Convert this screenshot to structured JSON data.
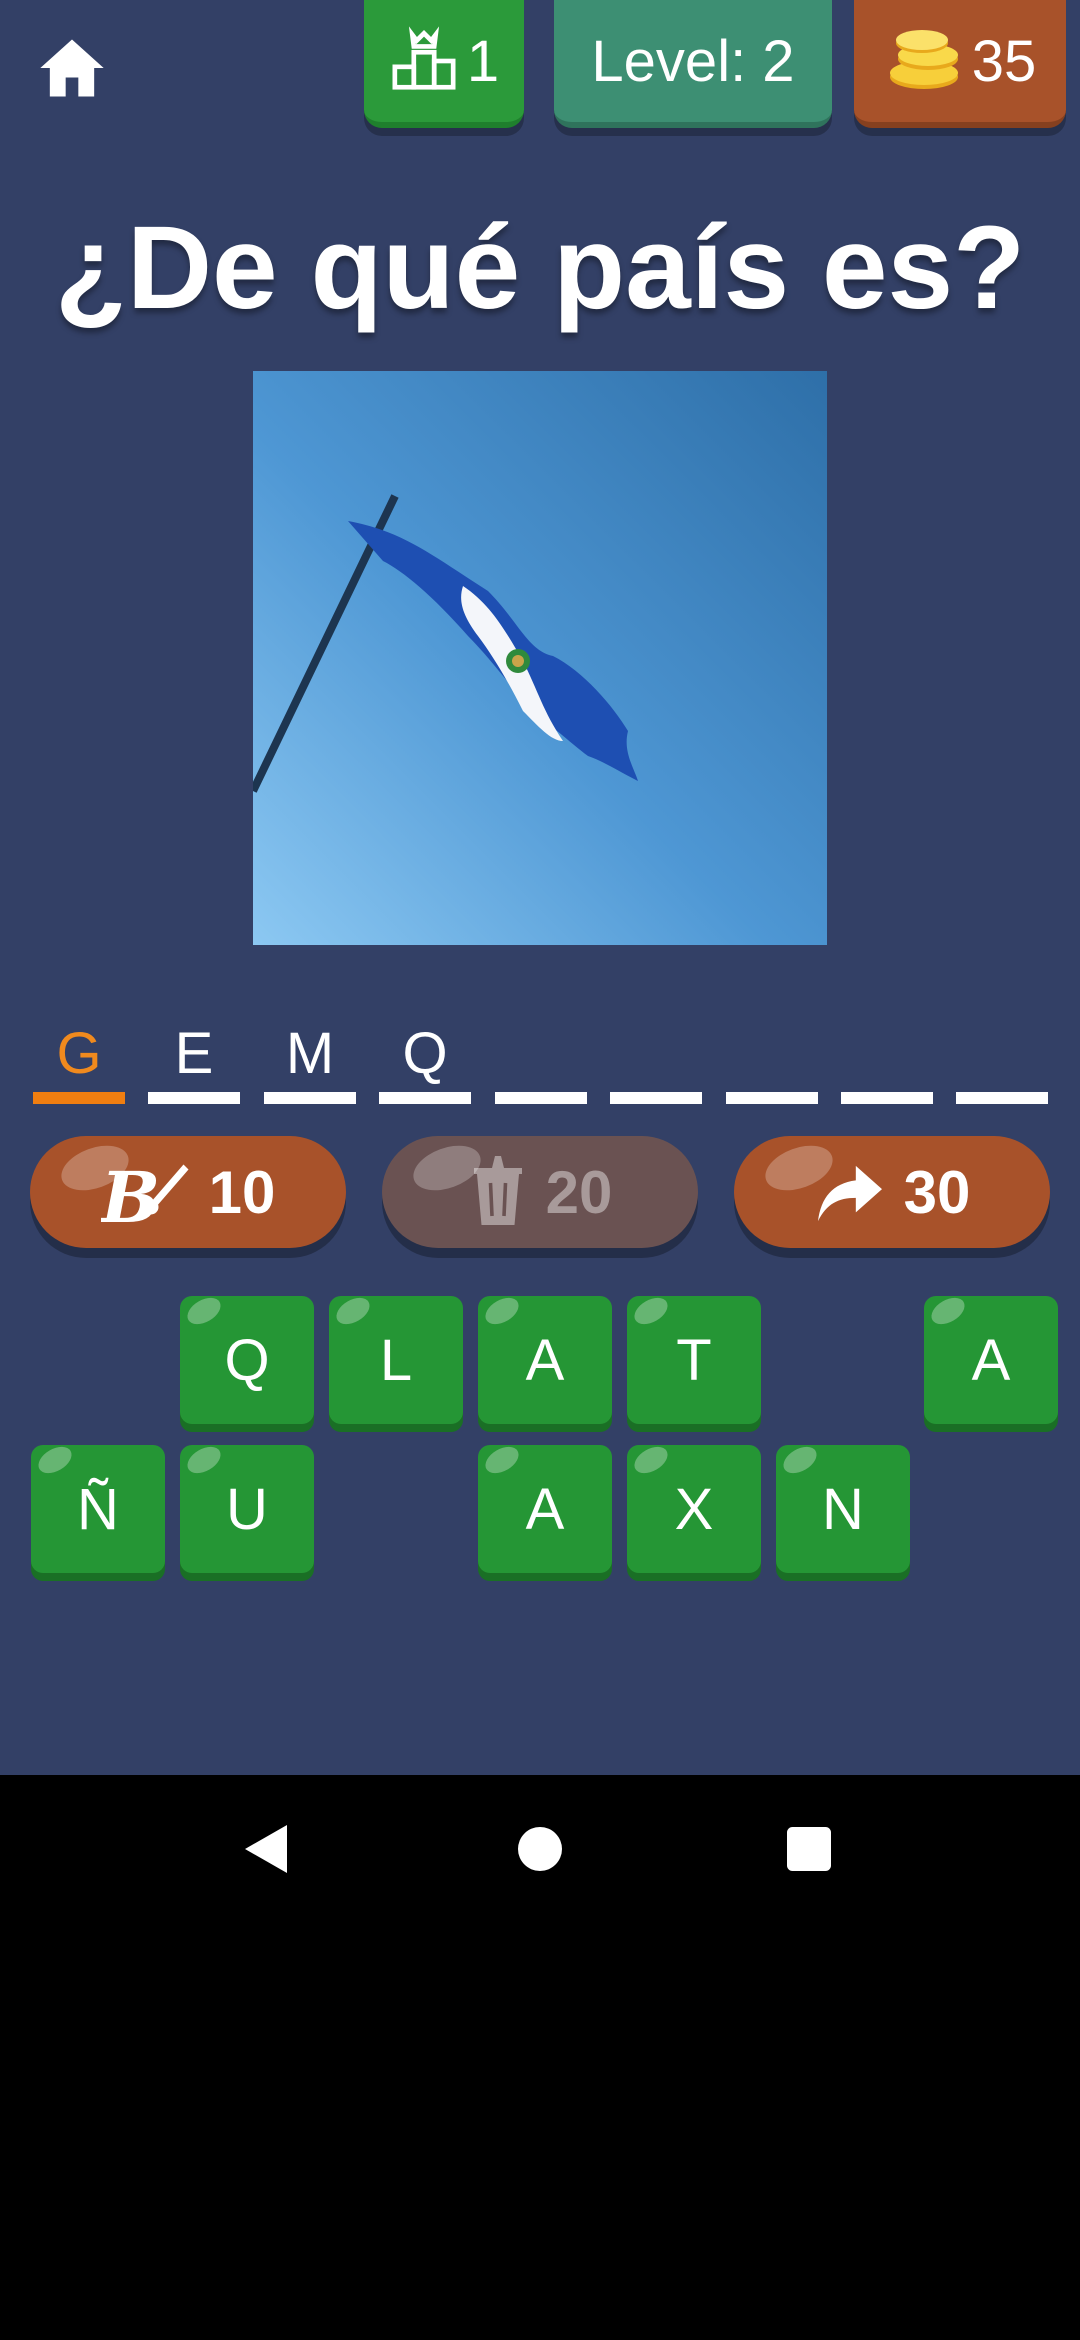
{
  "header": {
    "rank_value": "1",
    "level_text": "Level: 2",
    "coins_value": "35"
  },
  "question": "¿De qué país es?",
  "answer_slots": [
    "G",
    "E",
    "M",
    "Q",
    "",
    "",
    "",
    "",
    ""
  ],
  "powerups": [
    {
      "icon": "letter-reveal-icon",
      "cost": "10",
      "enabled": true
    },
    {
      "icon": "trash-icon",
      "cost": "20",
      "enabled": false
    },
    {
      "icon": "skip-arrow-icon",
      "cost": "30",
      "enabled": true
    }
  ],
  "keyboard": {
    "row1": [
      "",
      "Q",
      "L",
      "A",
      "T",
      "",
      "A"
    ],
    "row2": [
      "Ñ",
      "U",
      "",
      "A",
      "X",
      "N",
      ""
    ]
  },
  "colors": {
    "background": "#334066",
    "key_green": "#259635",
    "accent_orange": "#f07e10",
    "button_brown": "#a8522a"
  }
}
